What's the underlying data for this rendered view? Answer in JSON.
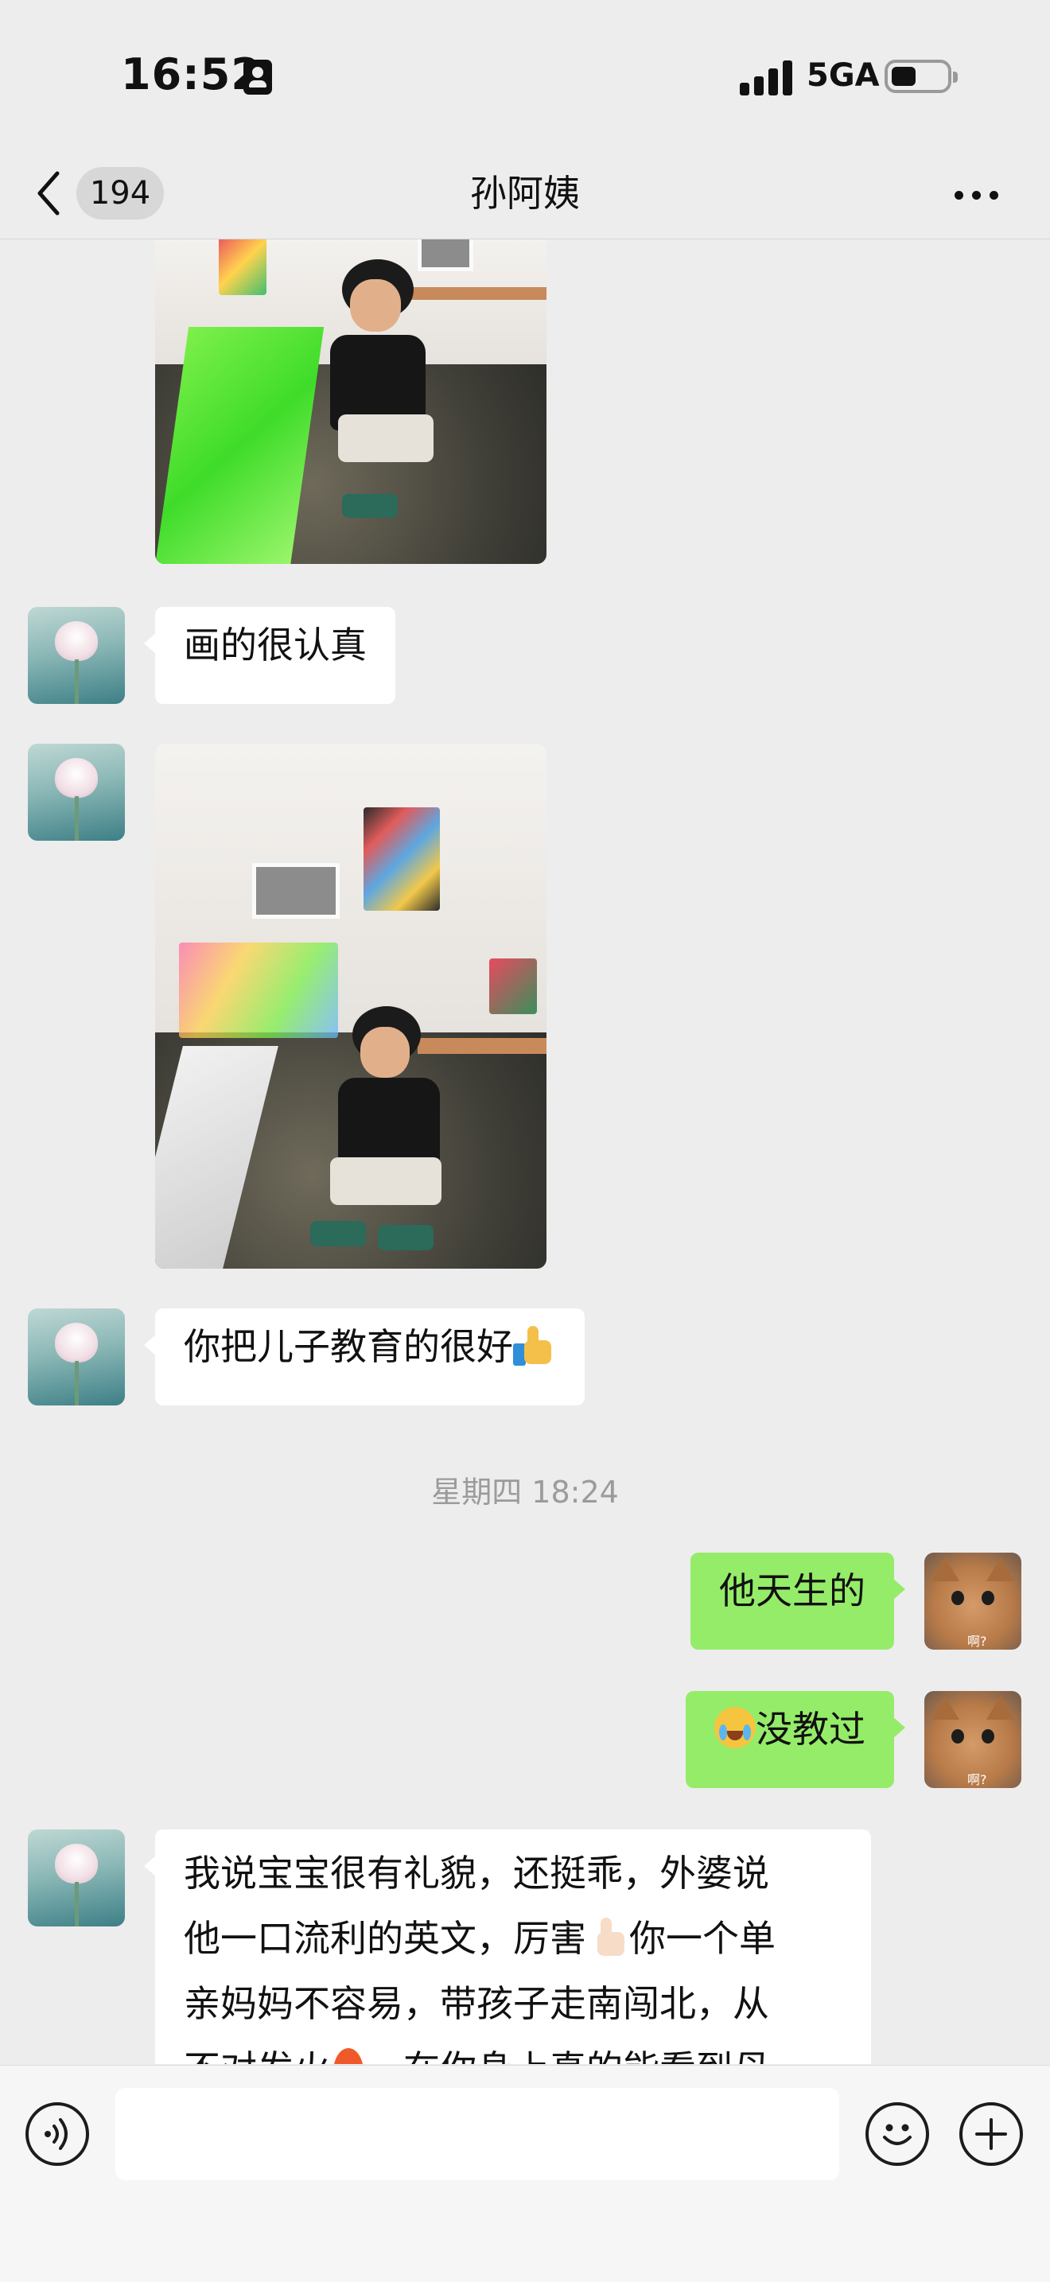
{
  "status_bar": {
    "time": "16:52",
    "network": "5GA",
    "signal_bars": 4,
    "battery_level": 0.4,
    "focus_icon": "person-badge-icon"
  },
  "nav": {
    "back_icon": "chevron-left-icon",
    "unread_count": "194",
    "title": "孙阿姨",
    "more_icon": "more-dots-icon"
  },
  "messages": [
    {
      "sender": "other",
      "type": "image",
      "content": "photo of boy painting (top portion)"
    },
    {
      "sender": "other",
      "type": "text",
      "text": "画的很认真"
    },
    {
      "sender": "other",
      "type": "image",
      "content": "photo of boy painting in art studio"
    },
    {
      "sender": "other",
      "type": "text",
      "text": "你把儿子教育的很好",
      "emoji": "thumbs-up"
    },
    {
      "type": "timestamp",
      "text": "星期四 18:24"
    },
    {
      "sender": "self",
      "type": "text",
      "text": "他天生的"
    },
    {
      "sender": "self",
      "type": "text",
      "emoji": "crying-laughing",
      "text": "没教过"
    },
    {
      "sender": "other",
      "type": "text",
      "lines": [
        "我说宝宝很有礼貌，还挺乖，外婆说",
        "他一口流利的英文，厉害",
        "你一个单",
        "亲妈妈不容易，带孩子走南闯北，从",
        "不对发火",
        "，在你身上真的能看到母"
      ]
    }
  ],
  "avatars": {
    "other": "lotus-flower-avatar",
    "self": "cat-avatar",
    "self_caption": "啊?"
  },
  "input_bar": {
    "voice_icon": "voice-icon",
    "mic_icon": "microphone-icon",
    "emoji_icon": "smiley-icon",
    "add_icon": "plus-icon",
    "text": ""
  }
}
